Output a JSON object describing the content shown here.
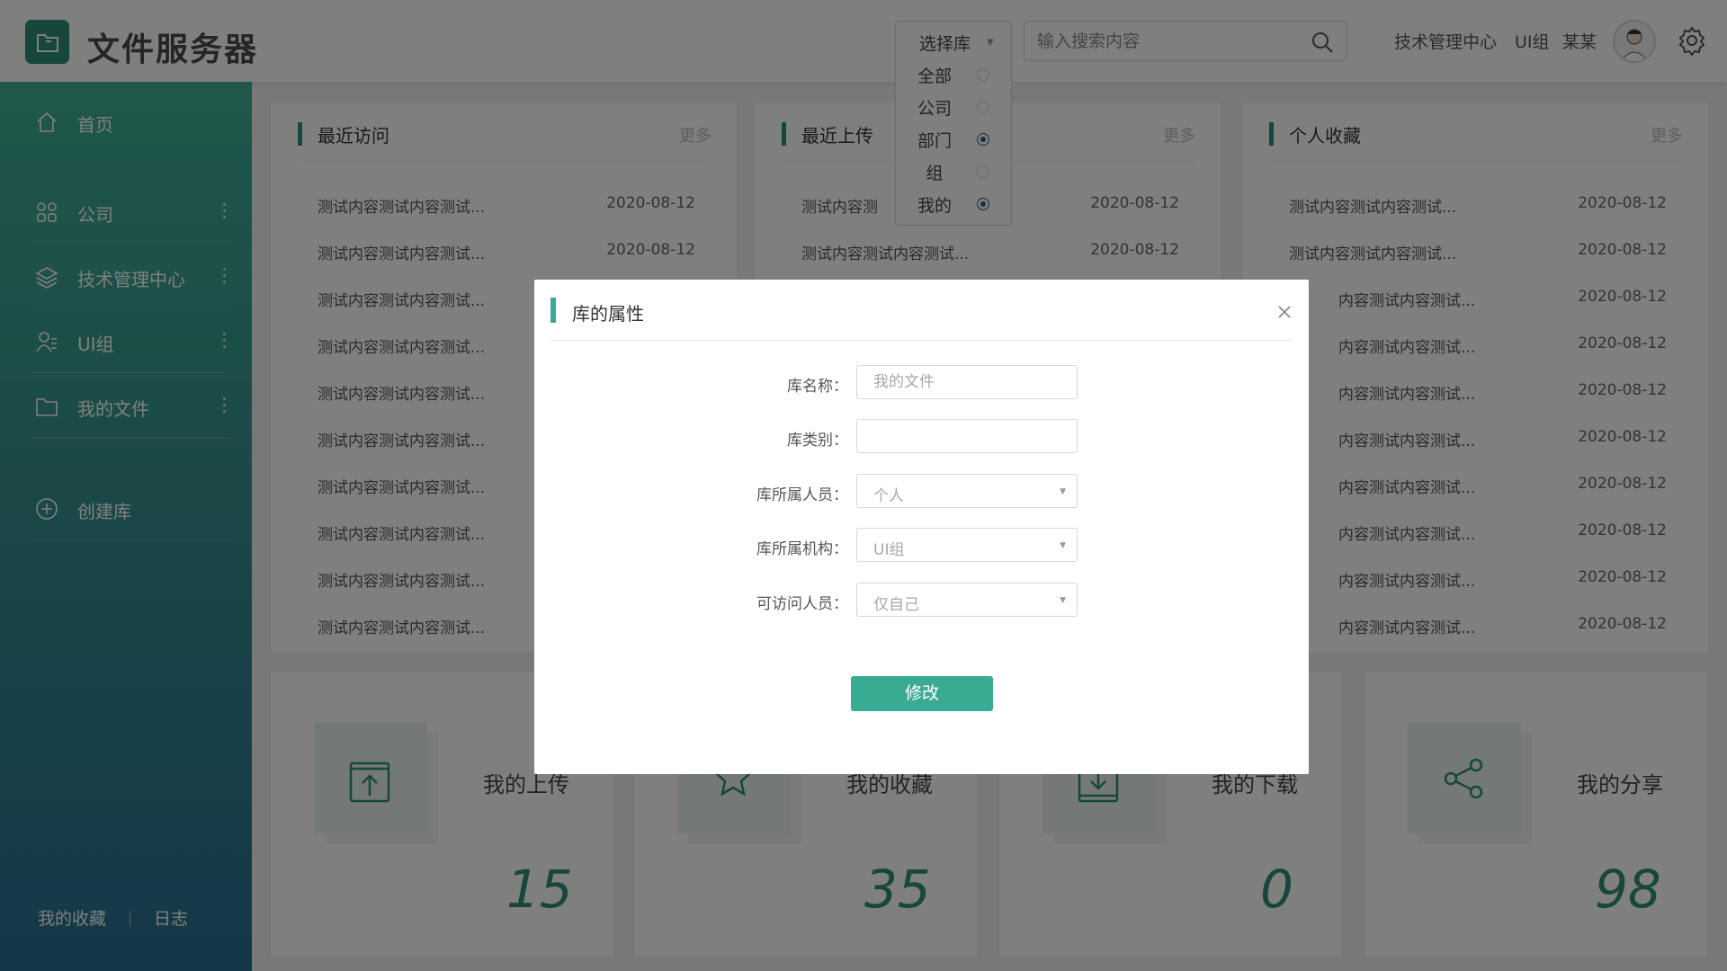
{
  "header": {
    "title": "文件服务器",
    "search_placeholder": "输入搜索内容",
    "org": "技术管理中心",
    "group": "UI组",
    "user": "某某"
  },
  "lib_select": {
    "label": "选择库",
    "options": [
      {
        "label": "全部",
        "selected": false
      },
      {
        "label": "公司",
        "selected": false
      },
      {
        "label": "部门",
        "selected": true
      },
      {
        "label": "组",
        "selected": false
      },
      {
        "label": "我的",
        "selected": true
      }
    ]
  },
  "sidebar": {
    "items": [
      {
        "label": "首页",
        "icon": "home-icon"
      },
      {
        "label": "公司",
        "icon": "grid-icon"
      },
      {
        "label": "技术管理中心",
        "icon": "layers-icon"
      },
      {
        "label": "UI组",
        "icon": "user-group-icon"
      },
      {
        "label": "我的文件",
        "icon": "folder-icon"
      },
      {
        "label": "创建库",
        "icon": "plus-circle-icon"
      }
    ],
    "footer": {
      "favorites": "我的收藏",
      "log": "日志"
    }
  },
  "panels": [
    {
      "title": "最近访问",
      "more": "更多",
      "rows": [
        {
          "text": "测试内容测试内容测试...",
          "date": "2020-08-12"
        },
        {
          "text": "测试内容测试内容测试...",
          "date": "2020-08-12"
        },
        {
          "text": "测试内容测试内容测试...",
          "date": ""
        },
        {
          "text": "测试内容测试内容测试...",
          "date": ""
        },
        {
          "text": "测试内容测试内容测试...",
          "date": ""
        },
        {
          "text": "测试内容测试内容测试...",
          "date": ""
        },
        {
          "text": "测试内容测试内容测试...",
          "date": ""
        },
        {
          "text": "测试内容测试内容测试...",
          "date": ""
        },
        {
          "text": "测试内容测试内容测试...",
          "date": ""
        },
        {
          "text": "测试内容测试内容测试...",
          "date": ""
        }
      ]
    },
    {
      "title": "最近上传",
      "more": "更多",
      "rows": [
        {
          "text": "测试内容测",
          "date": "2020-08-12"
        },
        {
          "text": "测试内容测试内容测试...",
          "date": "2020-08-12"
        }
      ]
    },
    {
      "title": "个人收藏",
      "more": "更多",
      "rows": [
        {
          "text": "测试内容测试内容测试...",
          "date": "2020-08-12"
        },
        {
          "text": "测试内容测试内容测试...",
          "date": "2020-08-12"
        },
        {
          "text": "内容测试内容测试...",
          "date": "2020-08-12"
        },
        {
          "text": "内容测试内容测试...",
          "date": "2020-08-12"
        },
        {
          "text": "内容测试内容测试...",
          "date": "2020-08-12"
        },
        {
          "text": "内容测试内容测试...",
          "date": "2020-08-12"
        },
        {
          "text": "内容测试内容测试...",
          "date": "2020-08-12"
        },
        {
          "text": "内容测试内容测试...",
          "date": "2020-08-12"
        },
        {
          "text": "内容测试内容测试...",
          "date": "2020-08-12"
        },
        {
          "text": "内容测试内容测试...",
          "date": "2020-08-12"
        }
      ]
    }
  ],
  "stats": [
    {
      "label": "我的上传",
      "value": "15",
      "icon": "upload-icon"
    },
    {
      "label": "我的收藏",
      "value": "35",
      "icon": "star-icon"
    },
    {
      "label": "我的下载",
      "value": "0",
      "icon": "download-icon"
    },
    {
      "label": "我的分享",
      "value": "98",
      "icon": "share-icon"
    }
  ],
  "modal": {
    "title": "库的属性",
    "fields": [
      {
        "label": "库名称：",
        "type": "input",
        "value": "",
        "placeholder": "我的文件"
      },
      {
        "label": "库类别：",
        "type": "input",
        "value": "",
        "placeholder": ""
      },
      {
        "label": "库所属人员：",
        "type": "select",
        "value": "个人"
      },
      {
        "label": "库所属机构：",
        "type": "select",
        "value": "UI组"
      },
      {
        "label": "可访问人员：",
        "type": "select",
        "value": "仅自己"
      }
    ],
    "submit": "修改"
  },
  "colors": {
    "brand": "#2f8f78",
    "button": "#3aab93",
    "sidebar_top": "#3fb096",
    "sidebar_bottom": "#2a6f8f",
    "radio_on": "#2b5f86"
  }
}
